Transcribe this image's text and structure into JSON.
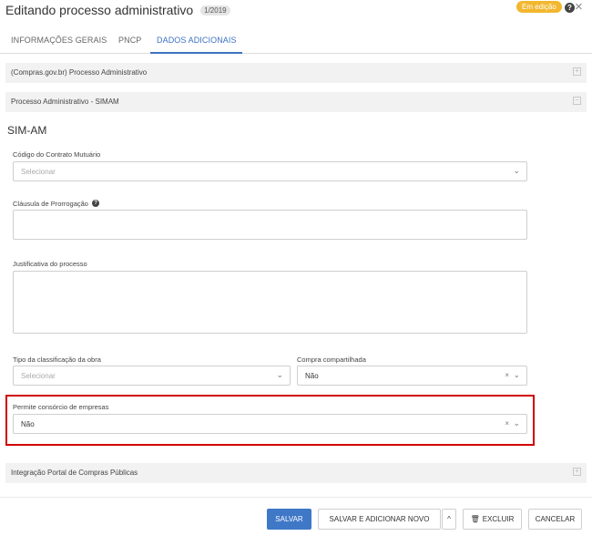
{
  "header": {
    "title": "Editando processo administrativo",
    "count": "1/2019",
    "status": "Em edição",
    "help_symbol": "?",
    "close_symbol": "×"
  },
  "tabs": [
    {
      "label": "INFORMAÇÕES GERAIS",
      "active": false
    },
    {
      "label": "PNCP",
      "active": false
    },
    {
      "label": "DADOS ADICIONAIS",
      "active": true
    }
  ],
  "panels": {
    "compras": {
      "label": "(Compras.gov.br) Processo Administrativo",
      "icon": "plus-square-icon",
      "symbol": "+"
    },
    "simam": {
      "label": "Processo Administrativo - SIMAM",
      "icon": "minus-square-icon",
      "symbol": "−"
    },
    "portal": {
      "label": "Integração Portal de Compras Públicas",
      "icon": "plus-square-icon",
      "symbol": "+"
    }
  },
  "form": {
    "section_title": "SIM-AM",
    "codigo_contrato": {
      "label": "Código do Contrato Mutuário",
      "placeholder": "Selecionar"
    },
    "clausula": {
      "label": "Cláusula de Prorrogação",
      "info_symbol": "?"
    },
    "justificativa": {
      "label": "Justificativa do processo"
    },
    "tipo_obra": {
      "label": "Tipo da classificação da obra",
      "placeholder": "Selecionar"
    },
    "compra_compartilhada": {
      "label": "Compra compartilhada",
      "value": "Não"
    },
    "consorcio": {
      "label": "Permite consórcio de empresas",
      "value": "Não"
    },
    "clear_symbol": "×",
    "chevron_symbol": "⌄"
  },
  "footer": {
    "salvar": "SALVAR",
    "salvar_novo": "SALVAR E ADICIONAR NOVO",
    "caret": "^",
    "trash_symbol": "🗑",
    "excluir": "EXCLUIR",
    "cancelar": "CANCELAR"
  },
  "colors": {
    "accent": "#3f78c7",
    "status": "#f2b72f",
    "highlight": "#d00000"
  }
}
